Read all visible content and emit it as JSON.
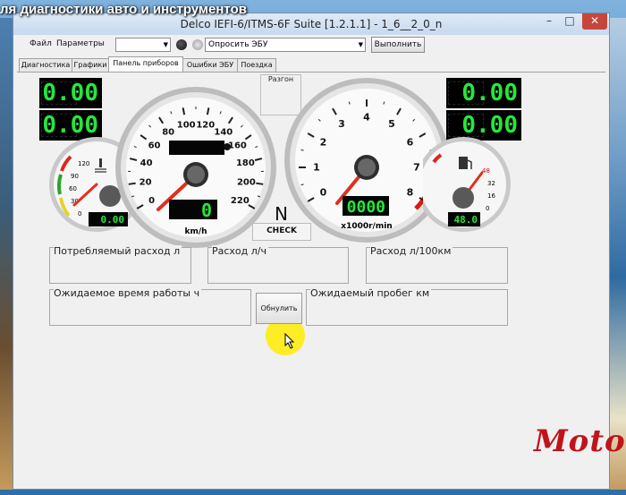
{
  "overlay_caption": "ля диагностики авто и инструментов",
  "window": {
    "title": "Delco IEFI-6/ITMS-6F Suite [1.2.1.1] - 1_6__2_0_n",
    "min_symbol": "–",
    "max_symbol": "□",
    "close_symbol": "✕"
  },
  "toolbar": {
    "menu_file": "Файл",
    "menu_params": "Параметры",
    "port_value": "",
    "action_value": "Опросить ЭБУ",
    "execute_label": "Выполнить"
  },
  "tabs": [
    {
      "label": "Диагностика"
    },
    {
      "label": "Графики"
    },
    {
      "label": "Панель приборов",
      "active": true
    },
    {
      "label": "Ошибки ЭБУ"
    },
    {
      "label": "Поездка"
    }
  ],
  "dashboard": {
    "left_panel": {
      "row1": "0.00",
      "row2": "0.00"
    },
    "right_panel": {
      "row1": "0.00",
      "row2": "0.00"
    },
    "start_label": "Разгон",
    "speedometer": {
      "ticks": [
        "0",
        "20",
        "40",
        "60",
        "80",
        "100",
        "120",
        "140",
        "160",
        "180",
        "200",
        "220"
      ],
      "unit": "km/h",
      "speed_digits": "0",
      "value": 0
    },
    "tachometer": {
      "ticks": [
        "0",
        "1",
        "2",
        "3",
        "4",
        "5",
        "6",
        "7",
        "8"
      ],
      "unit": "x1000r/min",
      "digits": "0000",
      "value": 0
    },
    "temp_gauge": {
      "ticks": [
        "120",
        "90",
        "60",
        "30",
        "0"
      ],
      "digits": "0.00",
      "icon": "coolant-thermometer-icon"
    },
    "fuel_gauge": {
      "ticks": [
        "48",
        "32",
        "16",
        "0"
      ],
      "digits": "48.0",
      "icon": "fuel-pump-icon"
    },
    "gear": "N",
    "check_label": "CHECK"
  },
  "readouts": {
    "fuel_total": "Потребляемый расход л",
    "fuel_hour": "Расход л/ч",
    "fuel_100": "Расход л/100км",
    "runtime": "Ожидаемое время работы ч",
    "mileage": "Ожидаемый пробег км",
    "reset_label": "Обнулить"
  },
  "watermark": "Motor",
  "colors": {
    "lcd_green": "#27e63c",
    "needle_red": "#e0301e",
    "accent_red": "#d61c10"
  }
}
